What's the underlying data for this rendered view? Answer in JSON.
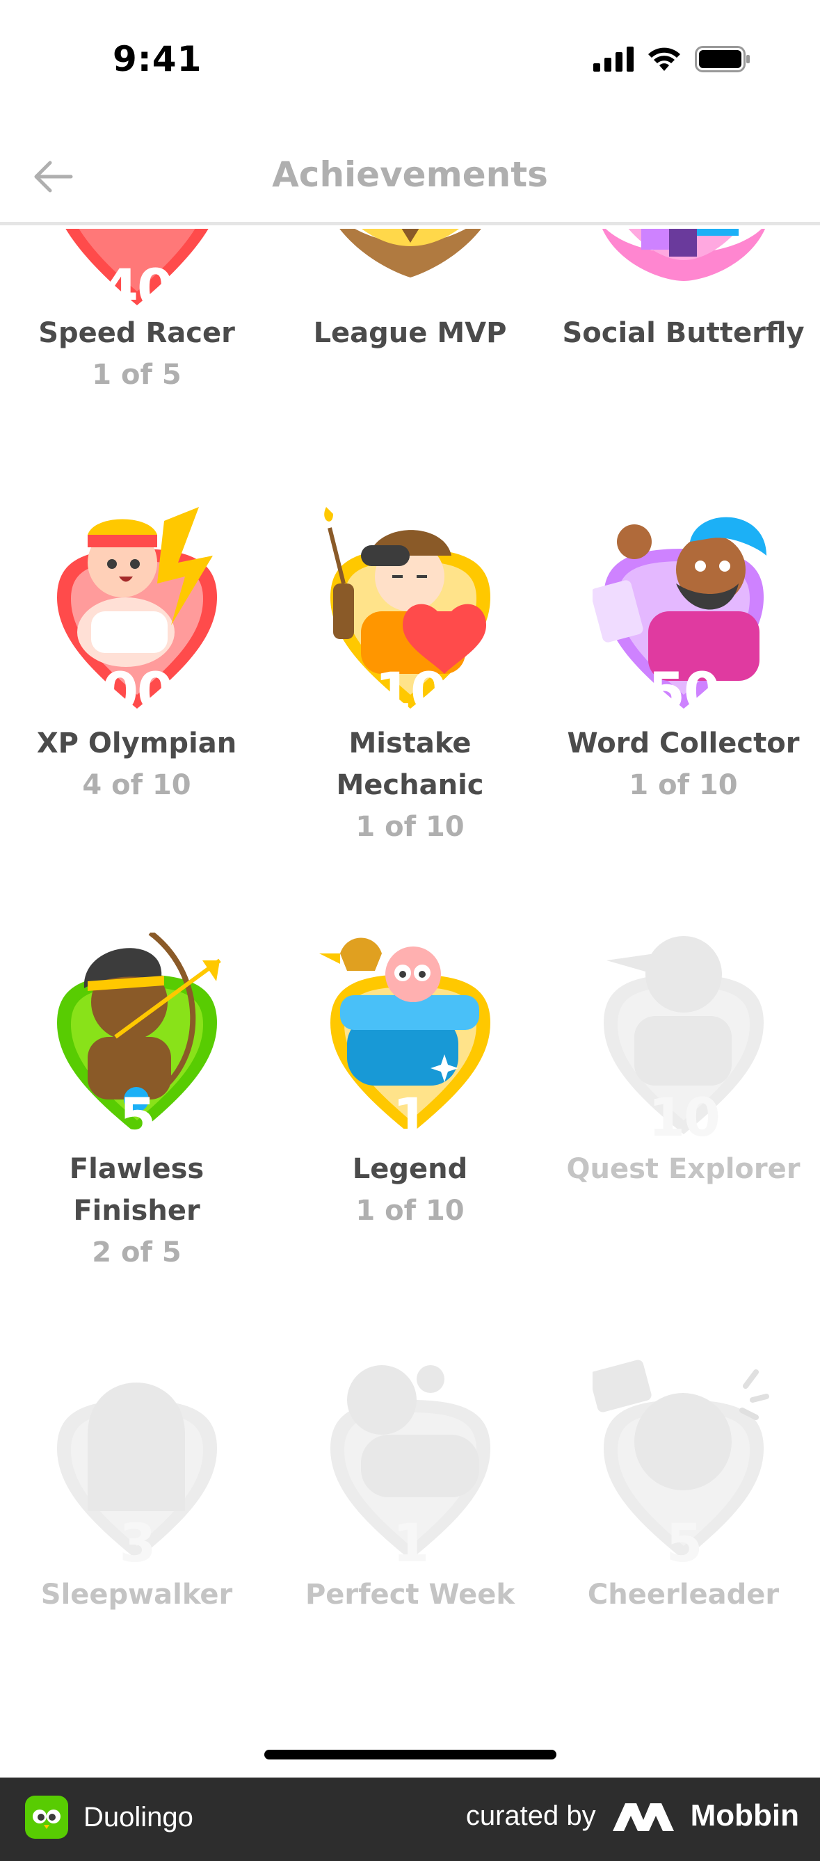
{
  "status": {
    "time": "9:41"
  },
  "header": {
    "title": "Achievements"
  },
  "achievements": [
    {
      "name": "Speed Racer",
      "progress": "1 of 5",
      "level": "40",
      "color": "#ff4b4b",
      "locked": false
    },
    {
      "name": "League MVP",
      "progress": "",
      "level": "",
      "color": "#e0a030",
      "locked": false
    },
    {
      "name": "Social Butterfly",
      "progress": "",
      "level": "",
      "color": "#ff86d0",
      "locked": false
    },
    {
      "name": "XP Olympian",
      "progress": "4 of 10",
      "level": "1000",
      "color": "#ff4b4b",
      "locked": false
    },
    {
      "name": "Mistake Mechanic",
      "name_line1": "Mistake",
      "name_line2": "Mechanic",
      "progress": "1 of 10",
      "level": "10",
      "color": "#ffc800",
      "locked": false
    },
    {
      "name": "Word Collector",
      "progress": "1 of 10",
      "level": "50",
      "color": "#ce82ff",
      "locked": false
    },
    {
      "name": "Flawless Finisher",
      "name_line1": "Flawless",
      "name_line2": "Finisher",
      "progress": "2 of 5",
      "level": "5",
      "color": "#58cc02",
      "locked": false
    },
    {
      "name": "Legend",
      "progress": "1 of 10",
      "level": "1",
      "color": "#ffc800",
      "locked": false
    },
    {
      "name": "Quest Explorer",
      "progress": "",
      "level": "10",
      "color": "#e5e5e5",
      "locked": true
    },
    {
      "name": "Sleepwalker",
      "progress": "",
      "level": "3",
      "color": "#e5e5e5",
      "locked": true
    },
    {
      "name": "Perfect Week",
      "progress": "",
      "level": "1",
      "color": "#e5e5e5",
      "locked": true
    },
    {
      "name": "Cheerleader",
      "progress": "",
      "level": "5",
      "color": "#e5e5e5",
      "locked": true
    }
  ],
  "footer": {
    "app_name": "Duolingo",
    "curated_by": "curated by",
    "brand": "Mobbin"
  }
}
